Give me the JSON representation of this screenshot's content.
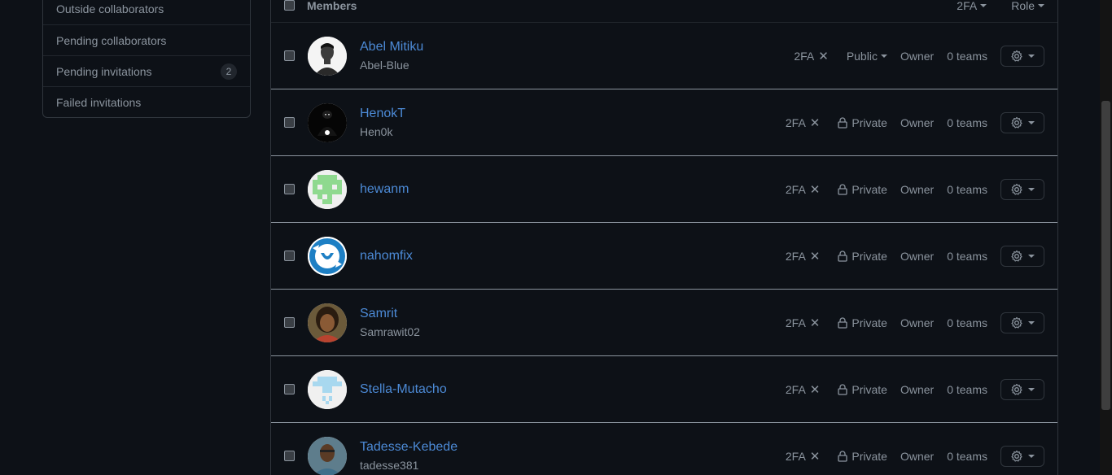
{
  "sidebar": {
    "items": [
      {
        "label": "Outside collaborators",
        "badge": ""
      },
      {
        "label": "Pending collaborators",
        "badge": ""
      },
      {
        "label": "Pending invitations",
        "badge": "2"
      },
      {
        "label": "Failed invitations",
        "badge": ""
      }
    ]
  },
  "members": {
    "header": "Members",
    "filter_2fa": "2FA",
    "filter_role": "Role",
    "rows": [
      {
        "name": "Abel Mitiku",
        "login": "Abel-Blue",
        "twofa": "2FA",
        "visibility": "Public",
        "role": "Owner",
        "teams": "0 teams"
      },
      {
        "name": "HenokT",
        "login": "Hen0k",
        "twofa": "2FA",
        "visibility": "Private",
        "role": "Owner",
        "teams": "0 teams"
      },
      {
        "name": "hewanm",
        "login": "",
        "twofa": "2FA",
        "visibility": "Private",
        "role": "Owner",
        "teams": "0 teams"
      },
      {
        "name": "nahomfix",
        "login": "",
        "twofa": "2FA",
        "visibility": "Private",
        "role": "Owner",
        "teams": "0 teams"
      },
      {
        "name": "Samrit",
        "login": "Samrawit02",
        "twofa": "2FA",
        "visibility": "Private",
        "role": "Owner",
        "teams": "0 teams"
      },
      {
        "name": "Stella-Mutacho",
        "login": "",
        "twofa": "2FA",
        "visibility": "Private",
        "role": "Owner",
        "teams": "0 teams"
      },
      {
        "name": "Tadesse-Kebede",
        "login": "tadesse381",
        "twofa": "2FA",
        "visibility": "Private",
        "role": "Owner",
        "teams": "0 teams"
      }
    ]
  },
  "icons": {
    "x": "x-icon",
    "lock": "lock-icon",
    "gear": "gear-icon",
    "caret": "caret-down-icon"
  },
  "colors": {
    "link": "#4c8ad6",
    "muted": "#8b949e",
    "background": "#0d1117"
  }
}
